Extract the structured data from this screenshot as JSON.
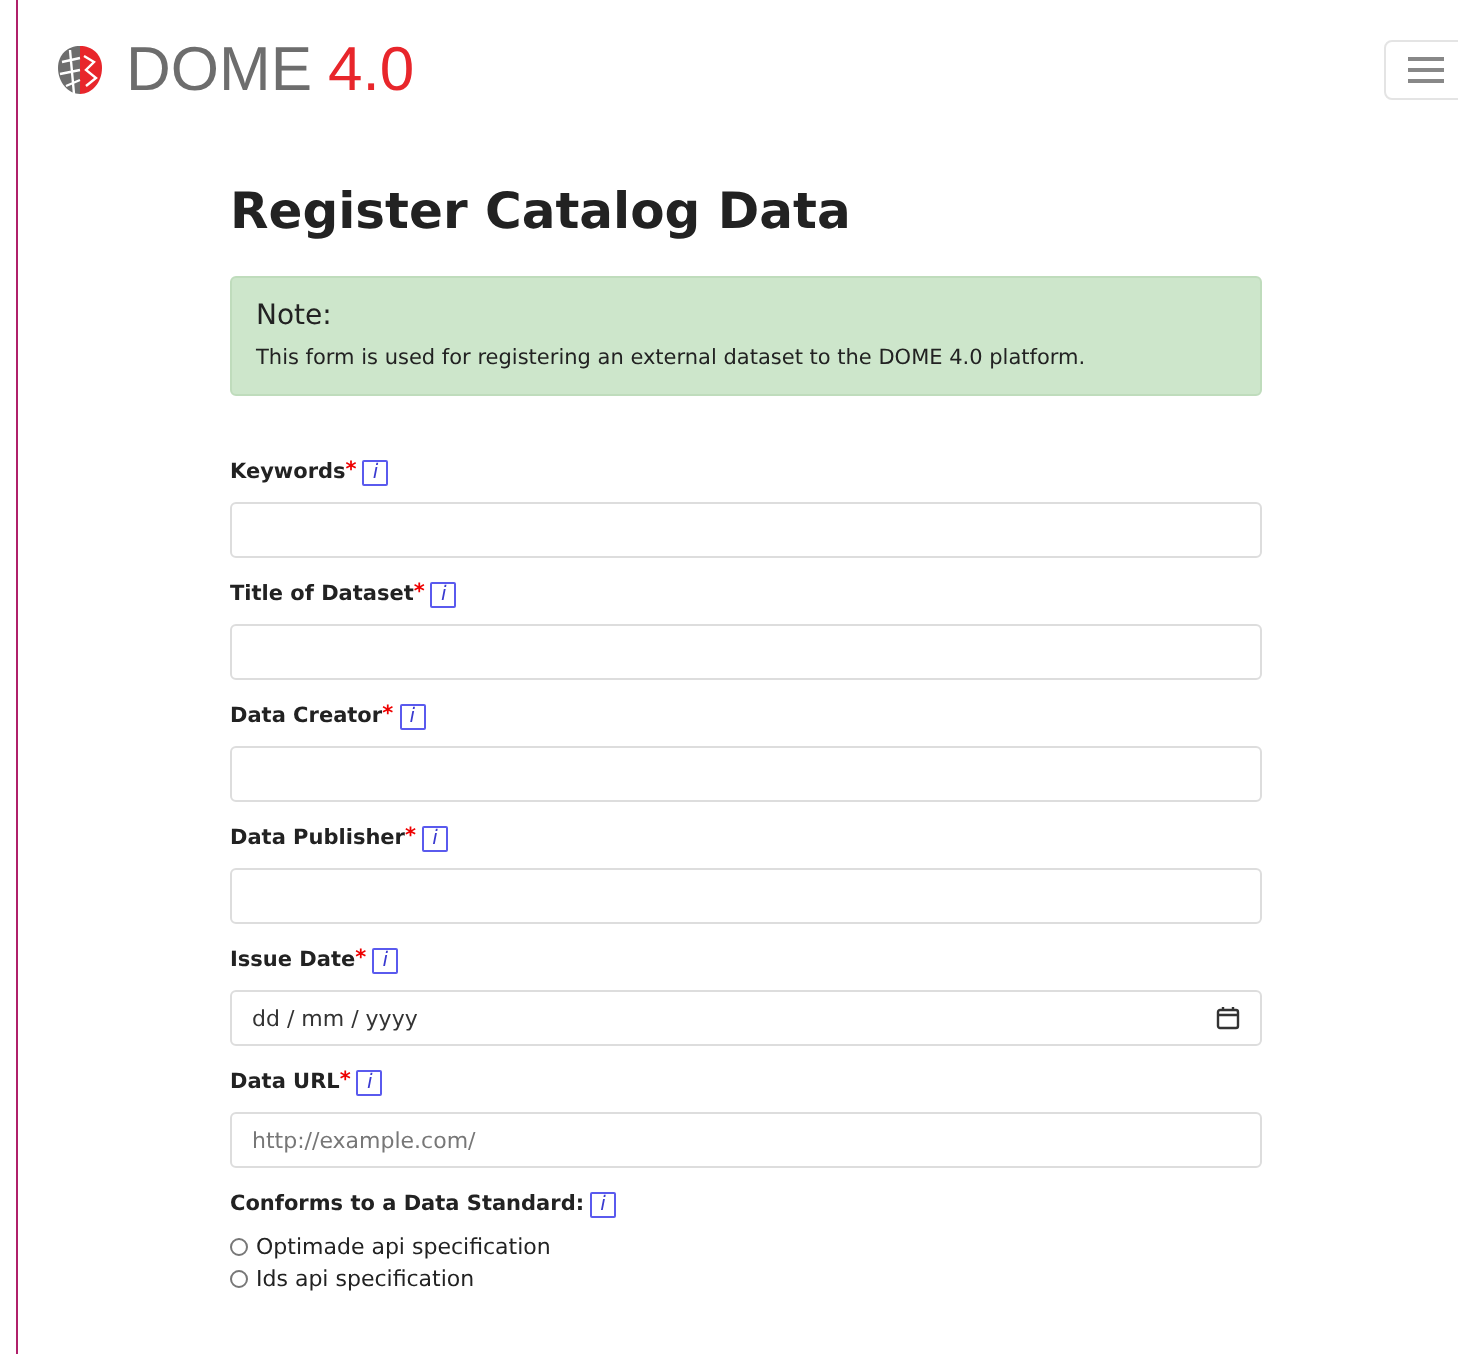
{
  "brand": {
    "name": "DOME",
    "version": "4.0"
  },
  "title": "Register Catalog Data",
  "note": {
    "heading": "Note:",
    "text": "This form is used for registering an external dataset to the DOME 4.0 platform."
  },
  "fields": [
    {
      "kind": "text",
      "label": "Keywords",
      "required_mark": "*",
      "info": "i"
    },
    {
      "kind": "text",
      "label": "Title of Dataset",
      "required_mark": "*",
      "info": "i"
    },
    {
      "kind": "text",
      "label": "Data Creator",
      "required_mark": "*",
      "info": "i"
    },
    {
      "kind": "text",
      "label": "Data Publisher",
      "required_mark": "*",
      "info": "i"
    },
    {
      "kind": "date",
      "label": "Issue Date",
      "required_mark": "*",
      "info": "i",
      "value": "dd / mm / yyyy"
    },
    {
      "kind": "text",
      "label": "Data URL",
      "required_mark": "*",
      "info": "i",
      "placeholder": "http://example.com/"
    },
    {
      "kind": "radio",
      "label": "Conforms to a Data Standard:",
      "info": "i",
      "options": [
        {
          "label": "Optimade api specification",
          "selected": false
        },
        {
          "label": "Ids api specification",
          "selected": false
        }
      ]
    }
  ]
}
